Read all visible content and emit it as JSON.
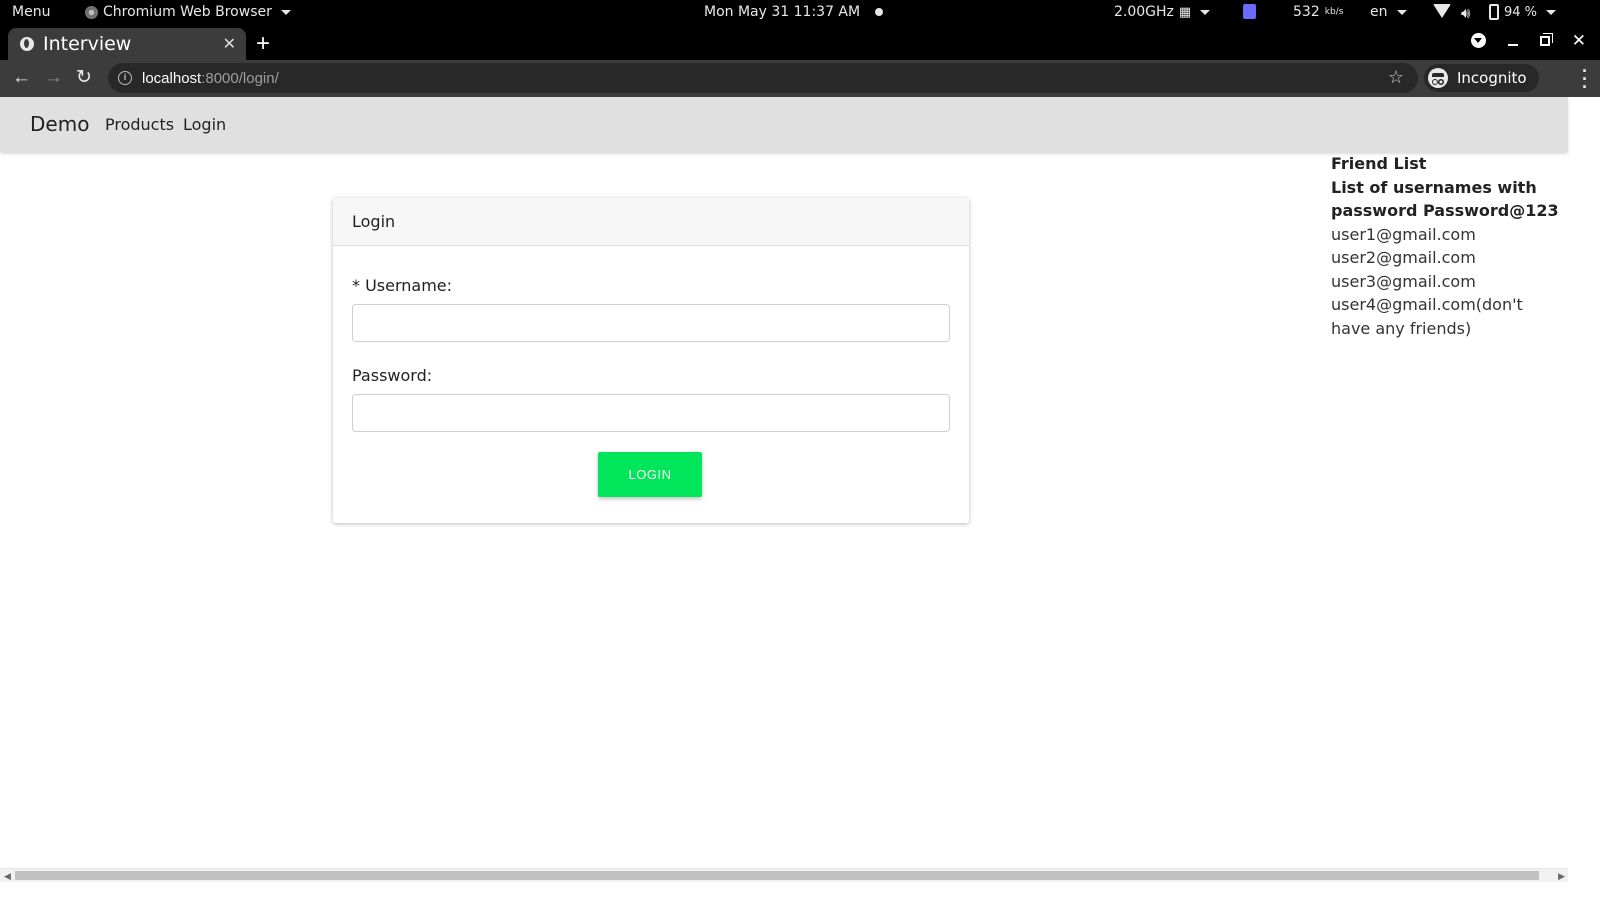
{
  "os_bar": {
    "menu": "Menu",
    "app_name": "Chromium Web Browser",
    "datetime": "Mon May 31  11:37 AM",
    "cpu_freq": "2.00GHz",
    "net_speed": "532",
    "net_unit": "kb/s",
    "language": "en",
    "battery": "94 %"
  },
  "browser": {
    "tab_title": "Interview",
    "url_host": "localhost",
    "url_rest": ":8000/login/",
    "incognito_label": "Incognito"
  },
  "navbar": {
    "brand": "Demo",
    "links": [
      "Products",
      "Login"
    ]
  },
  "login_card": {
    "header": "Login",
    "username_label": "* Username:",
    "username_value": "",
    "password_label": "Password:",
    "password_value": "",
    "button_label": "LOGIN"
  },
  "friend_panel": {
    "title": "Friend List",
    "subtitle_line1": "List of usernames with",
    "subtitle_line2": "password Password@123",
    "users": [
      "user1@gmail.com",
      "user2@gmail.com",
      "user3@gmail.com",
      "user4@gmail.com(don't have any friends)"
    ]
  },
  "colors": {
    "login_button": "#00e55a",
    "navbar_bg": "#e0e0e0"
  }
}
